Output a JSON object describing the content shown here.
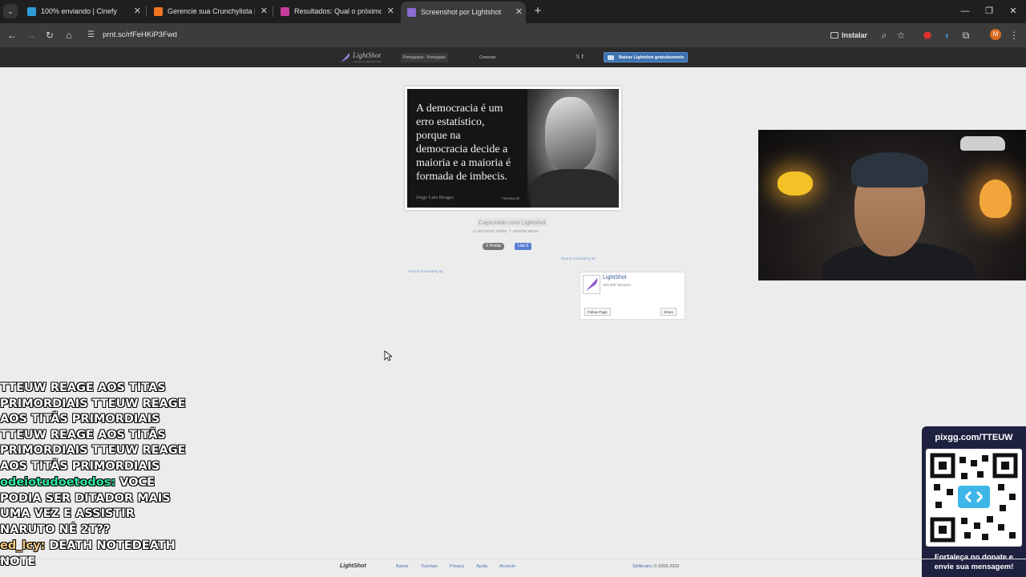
{
  "browser": {
    "tabs": [
      {
        "title": "100% enviando | Cinefy",
        "favicon_color": "#2f9bd8"
      },
      {
        "title": "Gerencie sua Crunchylista | Cru",
        "favicon_color": "#f47521"
      },
      {
        "title": "Resultados: Qual o próximo anime",
        "favicon_color": "#c63b9c"
      },
      {
        "title": "Screenshot por Lightshot",
        "favicon_color": "#8a6bd1"
      }
    ],
    "url": "prnt.sc/rfFeHKiP3Fwd",
    "install_label": "Instalar",
    "profile_initial": "M"
  },
  "lightshot": {
    "logo_name": "LightShot",
    "logo_tagline": "screen capture tool",
    "language": "Portuguese - Português",
    "connect": "Conectar",
    "social": "𝕏  f",
    "download_label": "Baixar Lightshot gratuitamente",
    "image": {
      "quote": "A democracia é um\nerro estatístico,\nporque na\ndemocracia decide a\nmaioria e a maioria é\nformada de imbecis.",
      "author": "Jorge Luis Borges",
      "brand": "PENSADOR"
    },
    "captured": "Capturado com Lightshot",
    "find_similar": "⊡ encontrar similar",
    "report_abuse": "⚐ reportar abuso",
    "tweet_label": "X Postar",
    "like_label": "Like 0",
    "report_ad_1": "Report misleading ad",
    "report_ad_2": "Report misleading ad",
    "fb": {
      "name": "LightShot",
      "followers": "383,509 followers",
      "follow": "Follow Page",
      "share": "Share"
    },
    "footer": {
      "logo": "LightShot",
      "links": [
        "Baixar",
        "Tutoriais",
        "Privacy",
        "Ajuda",
        "Anuncie"
      ],
      "company": "Skillbrains",
      "copyright": " © 2009-2022"
    }
  },
  "chat": {
    "message1": "TTEUW REAGE AOS TITAS PRIMORDIAIS TTEUW REAGE AOS TITÃS PRIMORDIAIS TTEUW REAGE AOS TITÃS PRIMORDIAIS TTEUW REAGE AOS TITÃS PRIMORDIAIS",
    "user2": "odeiotudoetodos:",
    "message2": " VOCE PODIA SER DITADOR MAIS UMA VEZ E ASSISTIR NARUTO NÉ 2T??",
    "user3": "ed_lcy:",
    "message3": " DEATH NOTEDEATH NOTE"
  },
  "donate": {
    "url": "pixgg.com/TTEUW",
    "caption": "Fortaleça no donate e\nenvie sua mensagem!"
  }
}
